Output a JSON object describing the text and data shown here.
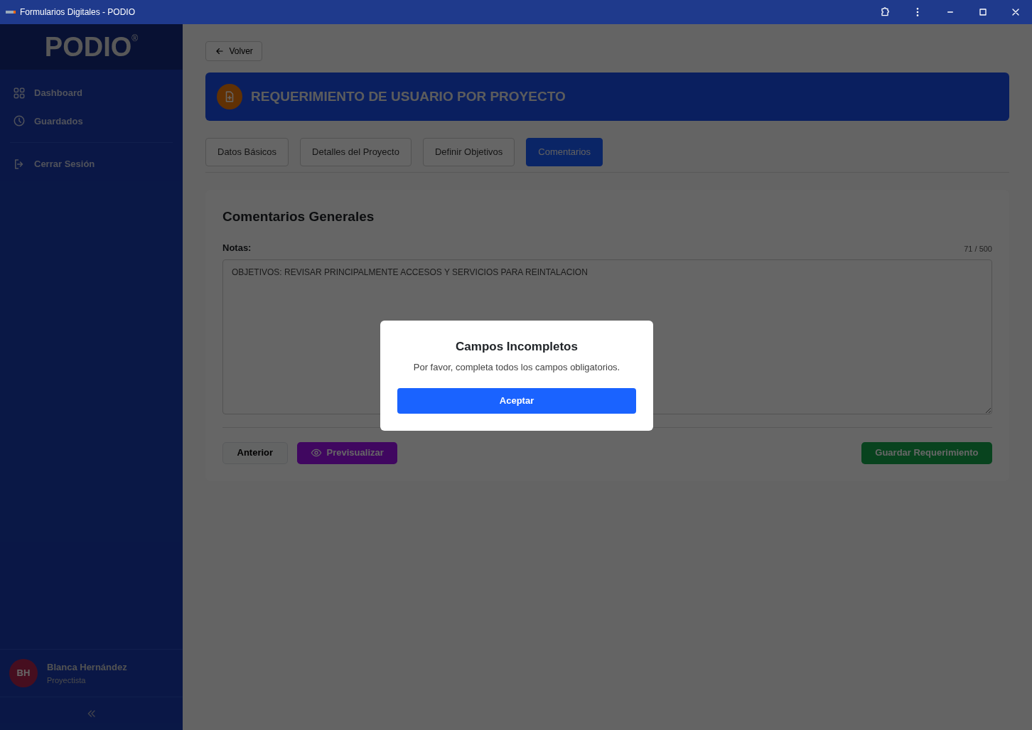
{
  "window": {
    "title": "Formularios Digitales - PODIO"
  },
  "sidebar": {
    "logo": "PODIO",
    "logo_mark": "®",
    "items": [
      {
        "label": "Dashboard",
        "kind": "grid"
      },
      {
        "label": "Guardados",
        "kind": "clock"
      }
    ],
    "logout": {
      "label": "Cerrar Sesión"
    },
    "user": {
      "initials": "BH",
      "name": "Blanca Hernández",
      "role": "Proyectista"
    }
  },
  "back_button": "Volver",
  "header": {
    "title": "REQUERIMIENTO DE USUARIO POR PROYECTO"
  },
  "tabs": [
    {
      "label": "Datos Básicos",
      "selected": false
    },
    {
      "label": "Detalles del Proyecto",
      "selected": false
    },
    {
      "label": "Definir Objetivos",
      "selected": false
    },
    {
      "label": "Comentarios",
      "selected": true
    }
  ],
  "section": {
    "title": "Comentarios Generales",
    "field_label": "Notas:",
    "counter": "71 / 500",
    "value": "OBJETIVOS: REVISAR PRINCIPALMENTE ACCESOS Y SERVICIOS PARA REINTALACION"
  },
  "actions": {
    "previous": "Anterior",
    "preview": "Previsualizar",
    "save": "Guardar Requerimiento"
  },
  "modal": {
    "title": "Campos Incompletos",
    "message": "Por favor, completa todos los campos obligatorios.",
    "button": "Aceptar"
  }
}
